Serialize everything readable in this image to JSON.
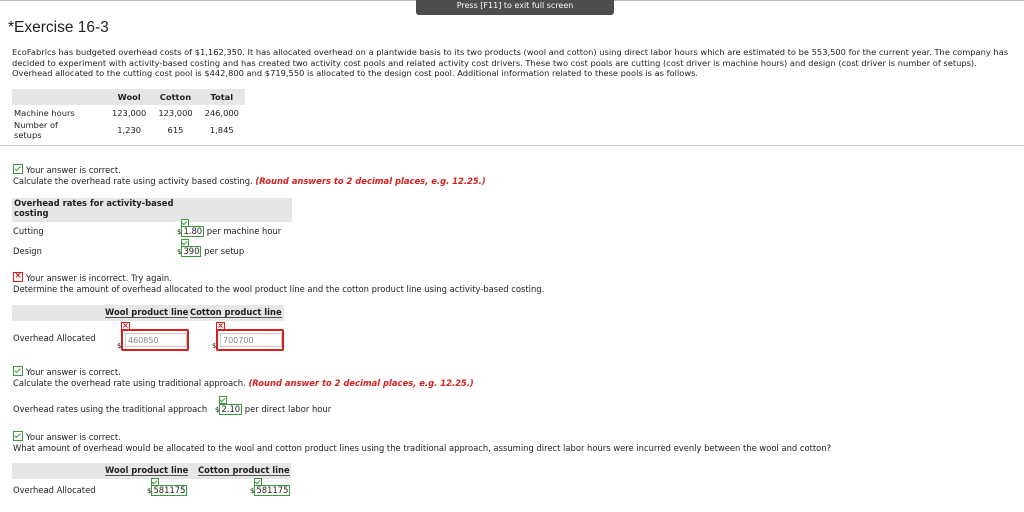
{
  "fullscreen_banner": "Press [F11] to exit full screen",
  "title": "*Exercise 16-3",
  "intro": "EcoFabrics has budgeted overhead costs of $1,162,350. It has allocated overhead on a plantwide basis to its two products (wool and cotton) using direct labor hours which are estimated to be 553,500 for the current year. The company has decided to experiment with activity-based costing and has created two activity cost pools and related activity cost drivers. These two cost pools are cutting (cost driver is machine hours) and design (cost driver is number of setups). Overhead allocated to the cutting cost pool is $442,800 and $719,550 is allocated to the design cost pool. Additional information related to these pools is as follows.",
  "info_table": {
    "headers": [
      "Wool",
      "Cotton",
      "Total"
    ],
    "rows": [
      {
        "label": "Machine hours",
        "values": [
          "123,000",
          "123,000",
          "246,000"
        ]
      },
      {
        "label": "Number of setups",
        "values": [
          "1,230",
          "615",
          "1,845"
        ]
      }
    ]
  },
  "q1": {
    "status": "Your answer is correct.",
    "prompt": "Calculate the overhead rate using activity based costing.",
    "hint": "(Round answers to 2 decimal places, e.g. 12.25.)",
    "table_header": "Overhead rates for activity-based costing",
    "rows": [
      {
        "label": "Cutting",
        "currency": "$",
        "value": "1.80",
        "unit": "per machine hour"
      },
      {
        "label": "Design",
        "currency": "$",
        "value": "390",
        "unit": "per setup"
      }
    ]
  },
  "q2": {
    "status": "Your answer is incorrect.  Try again.",
    "prompt": "Determine the amount of overhead allocated to the wool product line and the cotton product line using activity-based costing.",
    "col_wool": "Wool product line",
    "col_cotton": "Cotton product line",
    "row_label": "Overhead Allocated",
    "currency": "$",
    "wool_value": "460850",
    "cotton_value": "700700"
  },
  "q3": {
    "status": "Your answer is correct.",
    "prompt": "Calculate the overhead rate using traditional approach.",
    "hint": "(Round answer to 2 decimal places, e.g. 12.25.)",
    "label": "Overhead rates using the traditional approach",
    "currency": "$",
    "value": "2.10",
    "unit": "per direct labor hour"
  },
  "q4": {
    "status": "Your answer is correct.",
    "prompt": "What amount of overhead would be allocated to the wool and cotton product lines using the traditional approach, assuming direct labor hours were incurred evenly between the wool and cotton?",
    "col_wool": "Wool product line",
    "col_cotton": "Cotton product line",
    "row_label": "Overhead Allocated",
    "currency": "$",
    "wool_value": "581175",
    "cotton_value": "581175"
  },
  "colors": {
    "correct": "#3b9a3b",
    "incorrect": "#d42020",
    "header_bg": "#e6e6e6"
  }
}
